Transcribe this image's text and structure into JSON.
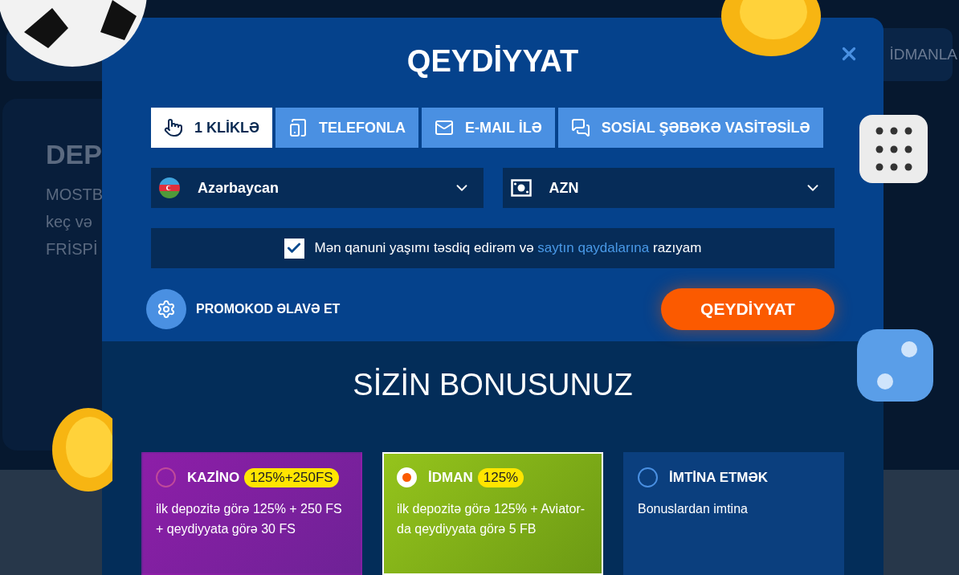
{
  "background": {
    "nav": [
      {
        "label": "İDMANLA",
        "kind": "link"
      }
    ],
    "promo": {
      "title": "DEP",
      "lines": [
        "MOSTB",
        "keç və",
        "FRİSPİ"
      ]
    }
  },
  "modal": {
    "title": "QEYDİYYAT",
    "tabs": [
      {
        "label": "1 KLİKLƏ",
        "selected": true
      },
      {
        "label": "TELEFONLA",
        "selected": false
      },
      {
        "label": "E-MAIL İLƏ",
        "selected": false
      },
      {
        "label": "SOSİAL ŞƏBƏKƏ VASİTƏSİLƏ",
        "selected": false
      }
    ],
    "country": "Azərbaycan",
    "currency": "AZN",
    "agreement": {
      "checked": true,
      "before": "Mən qanuni yaşımı təsdiq edirəm və ",
      "link": "saytın qaydalarına",
      "after": " razıyam"
    },
    "promo_code": "PROMOKOD ƏLAVƏ ET",
    "submit": "QEYDİYYAT",
    "bonus": {
      "title": "SİZİN BONUSUNUZ",
      "options": [
        {
          "kind": "casino",
          "title": "KAZİNO",
          "badge": "125%+250FS",
          "description": "ilk depozitə görə 125% + 250 FS + qeydiyyata görə 30 FS",
          "selected": false
        },
        {
          "kind": "sport",
          "title": "İDMAN",
          "badge": "125%",
          "description": "ilk depozitə görə 125% + Aviator-da qeydiyyata görə 5 FB",
          "selected": true
        },
        {
          "kind": "none",
          "title": "İMTİNA ETMƏK",
          "description": "Bonuslardan imtina",
          "selected": false
        }
      ]
    }
  }
}
